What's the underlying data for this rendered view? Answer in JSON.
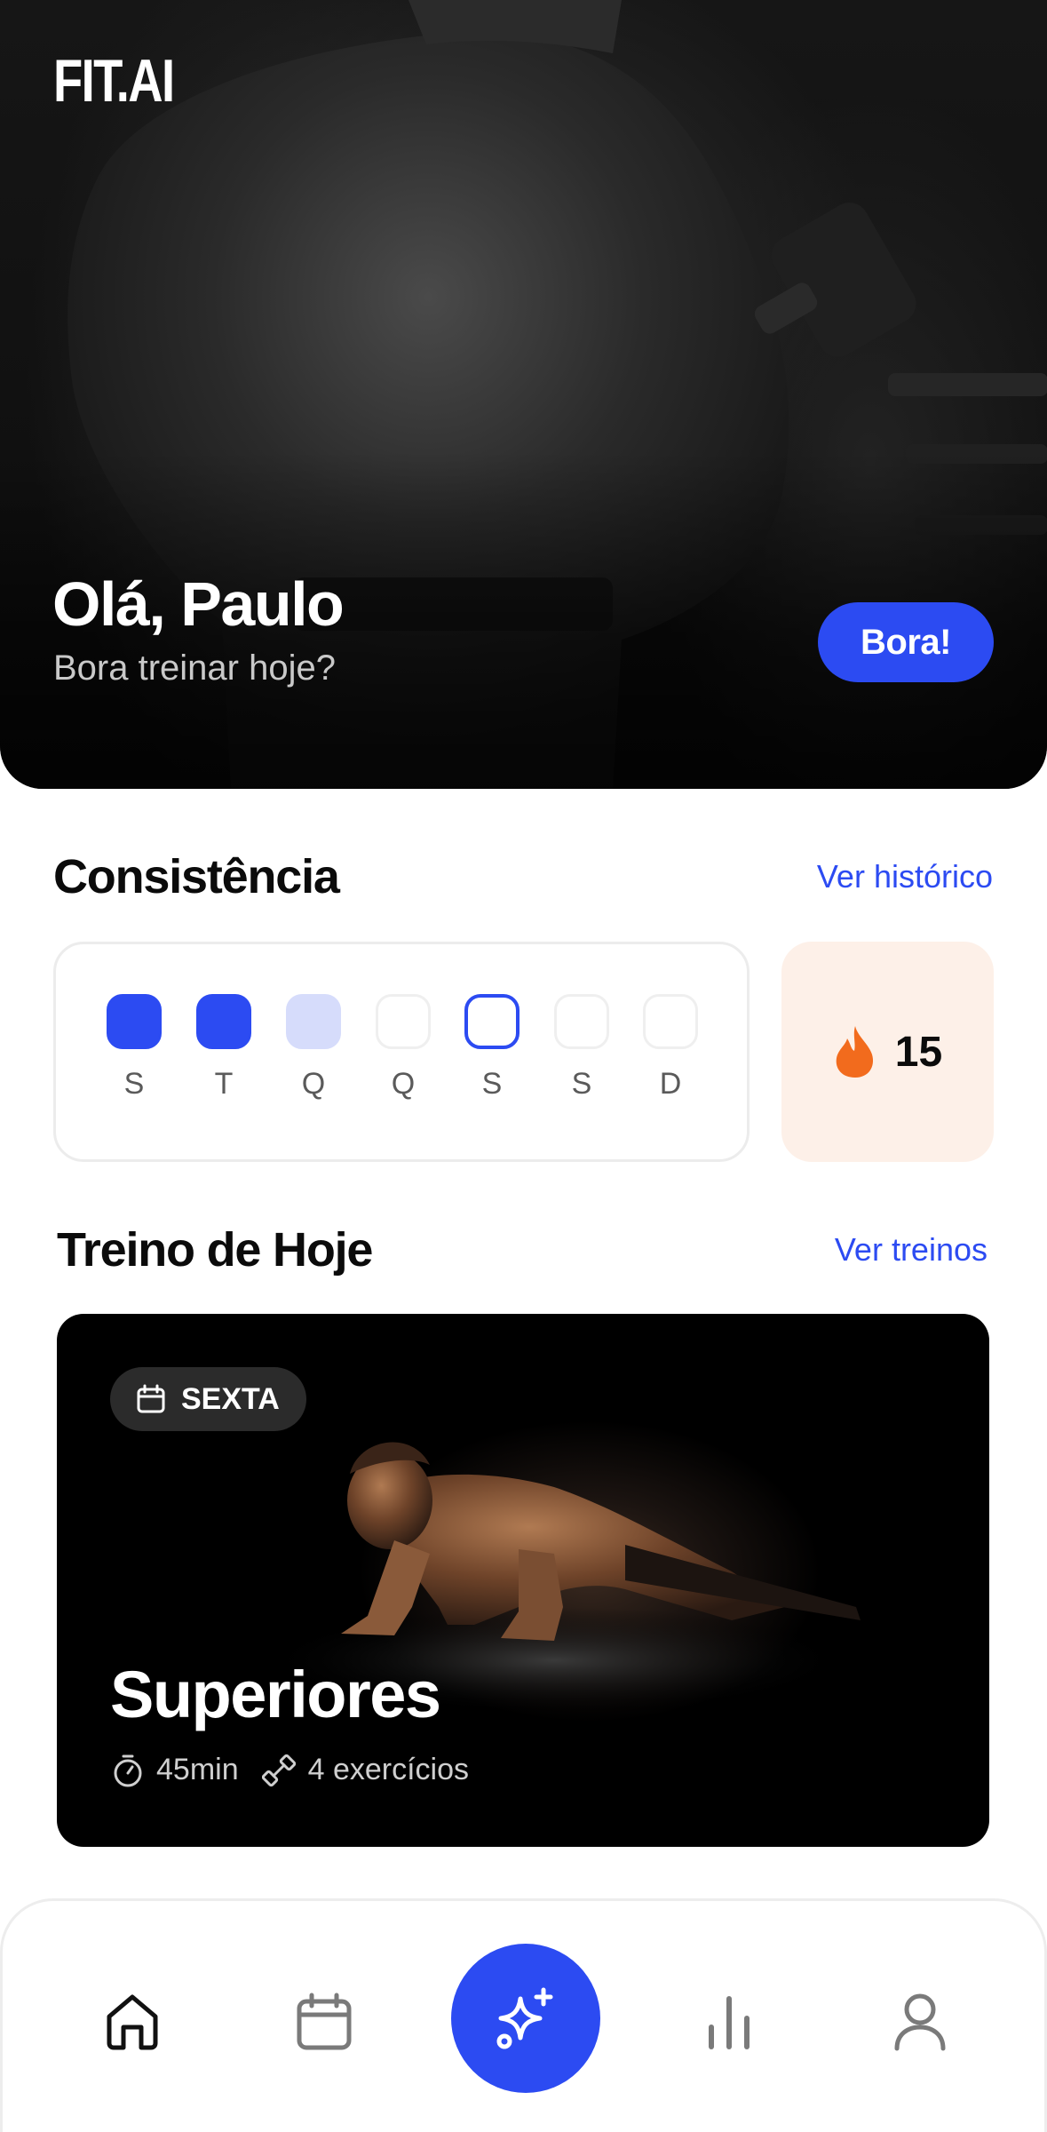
{
  "app": {
    "logo": "FIT.AI"
  },
  "hero": {
    "greeting": "Olá, Paulo",
    "subtitle": "Bora treinar hoje?",
    "cta_label": "Bora!"
  },
  "consistency": {
    "title": "Consistência",
    "link": "Ver histórico",
    "days": [
      {
        "label": "S",
        "state": "done"
      },
      {
        "label": "T",
        "state": "done"
      },
      {
        "label": "Q",
        "state": "partial"
      },
      {
        "label": "Q",
        "state": "empty"
      },
      {
        "label": "S",
        "state": "today"
      },
      {
        "label": "S",
        "state": "empty"
      },
      {
        "label": "D",
        "state": "empty"
      }
    ],
    "streak": {
      "icon": "flame-icon",
      "value": "15"
    }
  },
  "today_workout": {
    "title": "Treino de Hoje",
    "link": "Ver treinos",
    "day_badge": "SEXTA",
    "name": "Superiores",
    "duration": "45min",
    "exercises": "4 exercícios"
  },
  "nav": {
    "items": [
      "home-icon",
      "calendar-icon",
      "sparkles-icon",
      "stats-icon",
      "profile-icon"
    ]
  },
  "colors": {
    "accent": "#2c4bf2",
    "accent_light": "#d6dcfb",
    "streak_bg": "#fdf0e8",
    "flame": "#f26b1d"
  }
}
